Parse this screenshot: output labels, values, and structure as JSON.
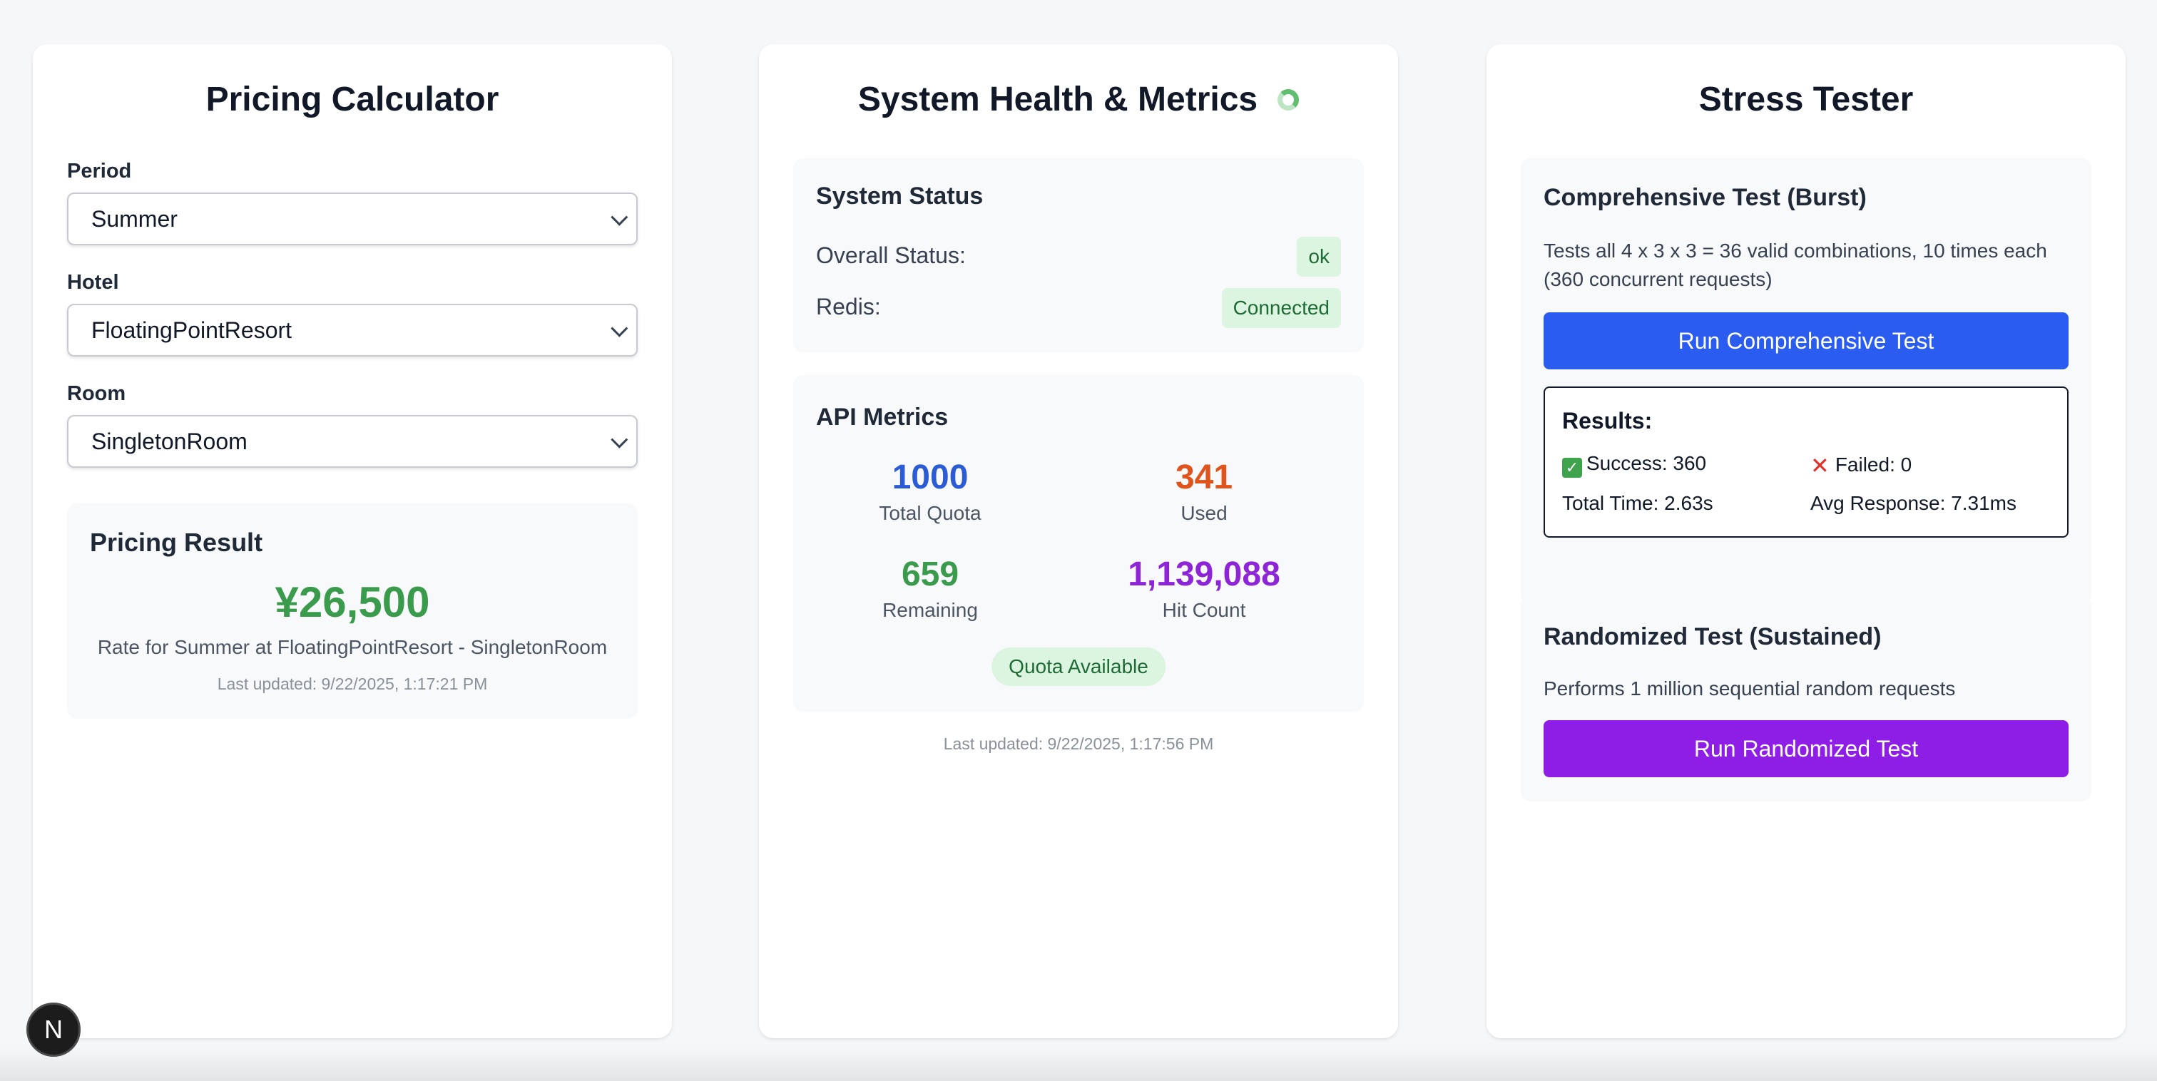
{
  "pricing": {
    "title": "Pricing Calculator",
    "period_label": "Period",
    "period_value": "Summer",
    "hotel_label": "Hotel",
    "hotel_value": "FloatingPointResort",
    "room_label": "Room",
    "room_value": "SingletonRoom",
    "result_title": "Pricing Result",
    "price": "¥26,500",
    "rate_text": "Rate for Summer at FloatingPointResort - SingletonRoom",
    "last_updated": "Last updated: 9/22/2025, 1:17:21 PM"
  },
  "health": {
    "title": "System Health & Metrics",
    "status_title": "System Status",
    "overall_label": "Overall Status:",
    "overall_value": "ok",
    "redis_label": "Redis:",
    "redis_value": "Connected",
    "metrics_title": "API Metrics",
    "metrics": [
      {
        "value": "1000",
        "label": "Total Quota",
        "color": "#2b5cd6"
      },
      {
        "value": "341",
        "label": "Used",
        "color": "#e0531a"
      },
      {
        "value": "659",
        "label": "Remaining",
        "color": "#3a9b4c"
      },
      {
        "value": "1,139,088",
        "label": "Hit Count",
        "color": "#8e24d8"
      }
    ],
    "quota_badge": "Quota Available",
    "last_updated": "Last updated: 9/22/2025, 1:17:56 PM"
  },
  "stress": {
    "title": "Stress Tester",
    "burst_title": "Comprehensive Test (Burst)",
    "burst_desc": "Tests all 4 x 3 x 3 = 36 valid combinations, 10 times each (360 concurrent requests)",
    "burst_button": "Run Comprehensive Test",
    "results_title": "Results:",
    "success_text": "Success: 360",
    "failed_text": "Failed: 0",
    "total_time": "Total Time: 2.63s",
    "avg_response": "Avg Response: 7.31ms",
    "random_title": "Randomized Test (Sustained)",
    "random_desc": "Performs 1 million sequential random requests",
    "random_button": "Run Randomized Test"
  },
  "dev_badge": "N"
}
